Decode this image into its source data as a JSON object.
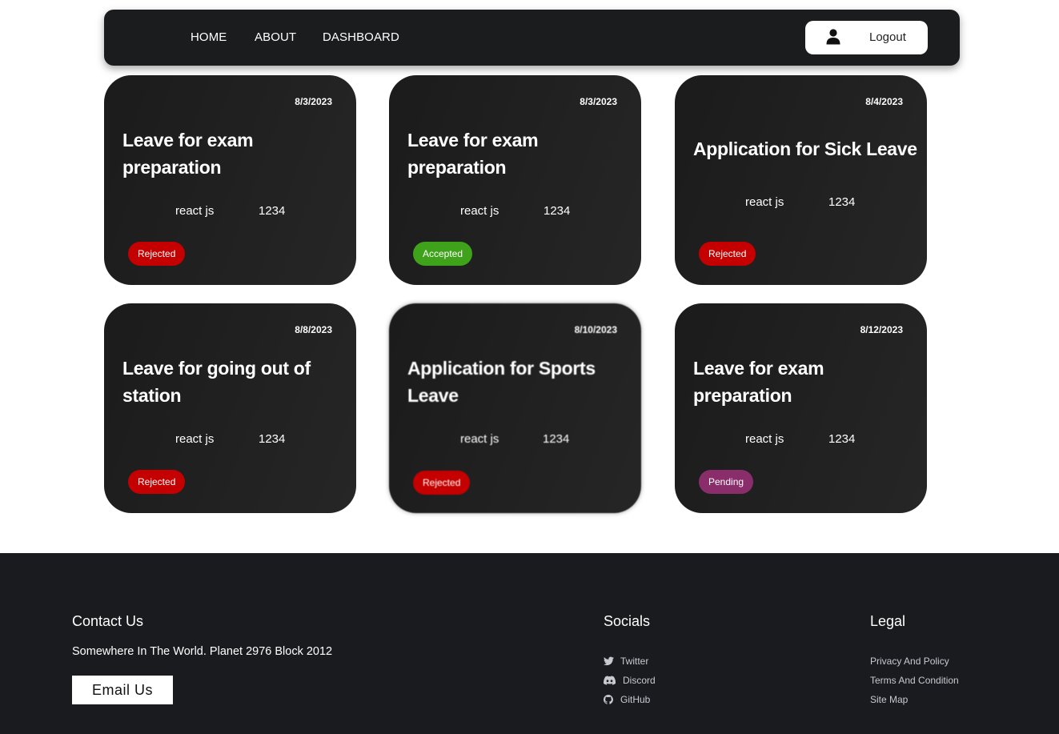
{
  "nav": {
    "links": [
      "HOME",
      "ABOUT",
      "DASHBOARD"
    ],
    "logout_label": "Logout",
    "user_icon": "user-icon"
  },
  "cards": [
    {
      "date": "8/3/2023",
      "title": "Leave for exam preparation",
      "name": "react js",
      "id": "1234",
      "status": "Rejected",
      "status_color": "#c40000"
    },
    {
      "date": "8/3/2023",
      "title": "Leave for exam preparation",
      "name": "react js",
      "id": "1234",
      "status": "Accepted",
      "status_color": "#3ea31a"
    },
    {
      "date": "8/4/2023",
      "title": "Application for Sick Leave",
      "name": "react js",
      "id": "1234",
      "status": "Rejected",
      "status_color": "#c40000"
    },
    {
      "date": "8/8/2023",
      "title": "Leave for going out of station",
      "name": "react js",
      "id": "1234",
      "status": "Rejected",
      "status_color": "#c40000"
    },
    {
      "date": "8/10/2023",
      "title": "Application for Sports Leave",
      "name": "react js",
      "id": "1234",
      "status": "Rejected",
      "status_color": "#c40000"
    },
    {
      "date": "8/12/2023",
      "title": "Leave for exam preparation",
      "name": "react js",
      "id": "1234",
      "status": "Pending",
      "status_color": "#8a2d6b"
    }
  ],
  "footer": {
    "contact_heading": "Contact Us",
    "address": "Somewhere In The World. Planet 2976 Block 2012",
    "email_button": "Email Us",
    "socials_heading": "Socials",
    "socials": [
      {
        "label": "Twitter",
        "icon": "twitter-icon"
      },
      {
        "label": "Discord",
        "icon": "discord-icon"
      },
      {
        "label": "GitHub",
        "icon": "github-icon"
      }
    ],
    "legal_heading": "Legal",
    "legal": [
      "Privacy And Policy",
      "Terms And Condition",
      "Site Map"
    ]
  }
}
